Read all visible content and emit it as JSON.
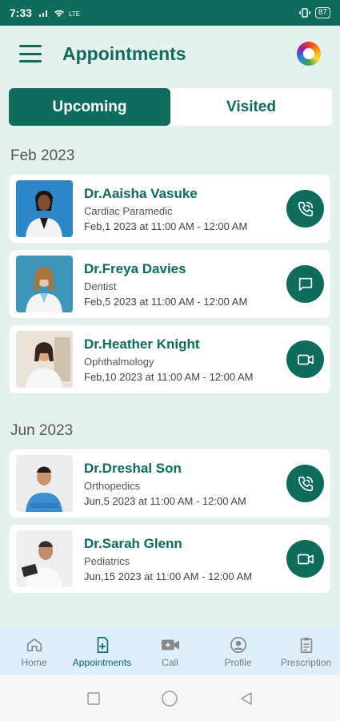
{
  "status_bar": {
    "time": "7:33",
    "battery": "87"
  },
  "header": {
    "title": "Appointments"
  },
  "tabs": [
    {
      "label": "Upcoming",
      "active": true
    },
    {
      "label": "Visited",
      "active": false
    }
  ],
  "sections": [
    {
      "month": "Feb 2023",
      "appointments": [
        {
          "name": "Dr.Aaisha Vasuke",
          "specialty": "Cardiac Paramedic",
          "time": "Feb,1 2023 at 11:00 AM - 12:00 AM",
          "action": "phone-icon"
        },
        {
          "name": "Dr.Freya Davies",
          "specialty": "Dentist",
          "time": "Feb,5 2023 at 11:00 AM - 12:00 AM",
          "action": "chat-icon"
        },
        {
          "name": "Dr.Heather Knight",
          "specialty": "Ophthalmology",
          "time": "Feb,10 2023 at 11:00 AM - 12:00 AM",
          "action": "video-icon"
        }
      ]
    },
    {
      "month": "Jun 2023",
      "appointments": [
        {
          "name": "Dr.Dreshal Son",
          "specialty": "Orthopedics",
          "time": "Jun,5 2023 at 11:00 AM - 12:00 AM",
          "action": "phone-icon"
        },
        {
          "name": "Dr.Sarah Glenn",
          "specialty": "Pediatrics",
          "time": "Jun,15 2023 at 11:00 AM - 12:00 AM",
          "action": "video-icon"
        }
      ]
    }
  ],
  "bottom_nav": [
    {
      "label": "Home",
      "icon": "home-icon",
      "active": false
    },
    {
      "label": "Appointments",
      "icon": "appointments-icon",
      "active": true
    },
    {
      "label": "Call",
      "icon": "video-call-icon",
      "active": false
    },
    {
      "label": "Profile",
      "icon": "profile-icon",
      "active": false
    },
    {
      "label": "Prescription",
      "icon": "prescription-icon",
      "active": false
    }
  ],
  "colors": {
    "primary": "#0f6b5b",
    "background": "#e5f1ef",
    "nav_background": "#dfeefb"
  }
}
